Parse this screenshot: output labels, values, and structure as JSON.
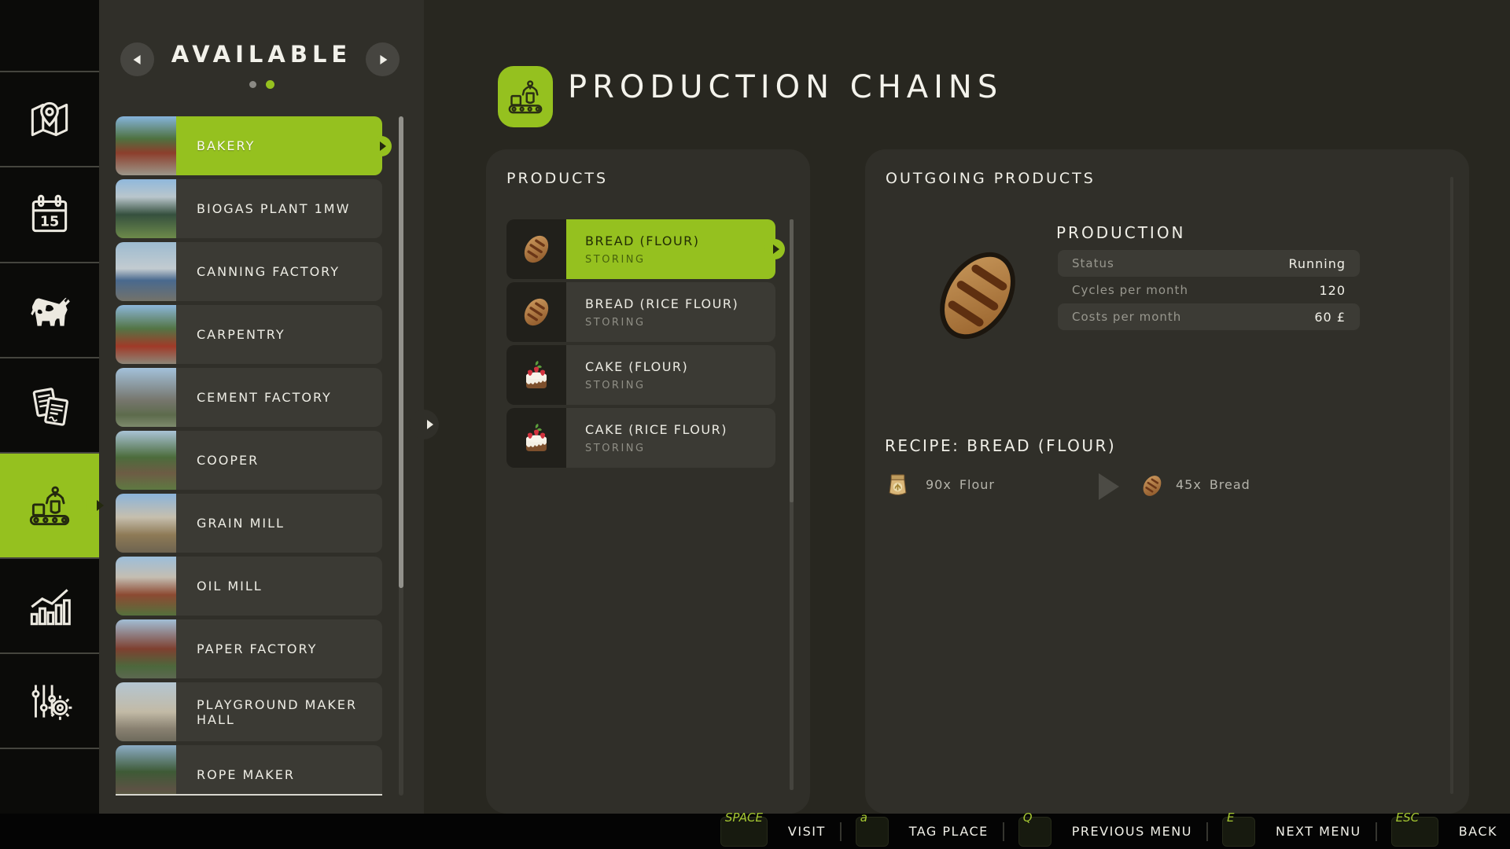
{
  "colors": {
    "accent_green": "#95c11f",
    "key_green": "#a6c832",
    "panel_bg": "#302f29"
  },
  "sidebar": {
    "calendar_day": "15",
    "items": [
      "map",
      "calendar",
      "animals",
      "contracts",
      "production",
      "statistics",
      "settings"
    ],
    "selected": "production"
  },
  "building_panel": {
    "title": "AVAILABLE",
    "pagination": {
      "dot_count": 2,
      "active_index": 1
    },
    "items": [
      {
        "label": "BAKERY",
        "selected": true
      },
      {
        "label": "BIOGAS PLANT 1MW"
      },
      {
        "label": "CANNING FACTORY"
      },
      {
        "label": "CARPENTRY"
      },
      {
        "label": "CEMENT FACTORY"
      },
      {
        "label": "COOPER"
      },
      {
        "label": "GRAIN MILL"
      },
      {
        "label": "OIL MILL"
      },
      {
        "label": "PAPER FACTORY"
      },
      {
        "label": "PLAYGROUND MAKER HALL"
      },
      {
        "label": "ROPE MAKER"
      }
    ]
  },
  "header": {
    "title": "PRODUCTION CHAINS"
  },
  "products_panel": {
    "title": "PRODUCTS",
    "items": [
      {
        "label": "BREAD (FLOUR)",
        "status": "STORING",
        "icon": "bread",
        "selected": true
      },
      {
        "label": "BREAD (RICE FLOUR)",
        "status": "STORING",
        "icon": "bread"
      },
      {
        "label": "CAKE (FLOUR)",
        "status": "STORING",
        "icon": "cake"
      },
      {
        "label": "CAKE (RICE FLOUR)",
        "status": "STORING",
        "icon": "cake"
      }
    ]
  },
  "outgoing_panel": {
    "title": "OUTGOING PRODUCTS",
    "production": {
      "title": "PRODUCTION",
      "rows": [
        {
          "label": "Status",
          "value": "Running"
        },
        {
          "label": "Cycles per month",
          "value": "120"
        },
        {
          "label": "Costs per month",
          "value": "60 £"
        }
      ]
    },
    "recipe": {
      "title": "RECIPE: BREAD (FLOUR)",
      "input": {
        "qty": "90x",
        "name": "Flour"
      },
      "output": {
        "qty": "45x",
        "name": "Bread"
      }
    }
  },
  "bottom_bar": {
    "hints": [
      {
        "key": "SPACE",
        "action": "VISIT"
      },
      {
        "key": "a",
        "action": "TAG PLACE"
      },
      {
        "key": "Q",
        "action": "PREVIOUS MENU"
      },
      {
        "key": "E",
        "action": "NEXT MENU"
      },
      {
        "key": "ESC",
        "action": "BACK"
      }
    ]
  }
}
